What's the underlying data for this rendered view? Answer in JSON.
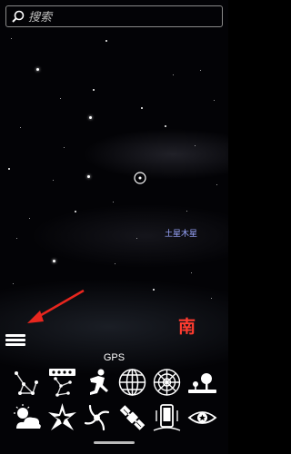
{
  "search": {
    "placeholder": "搜索"
  },
  "sky": {
    "planet_label": "土星木星",
    "compass_direction": "南"
  },
  "toolbar": {
    "gps_label": "GPS",
    "row1": [
      "constellation-lines-icon",
      "constellation-names-icon",
      "constellation-art-icon",
      "equatorial-grid-icon",
      "azimuthal-grid-icon",
      "ground-icon"
    ],
    "row2": [
      "atmosphere-icon",
      "deep-sky-icon",
      "galaxy-icon",
      "satellite-icon",
      "night-mode-icon",
      "eye-icon"
    ]
  }
}
